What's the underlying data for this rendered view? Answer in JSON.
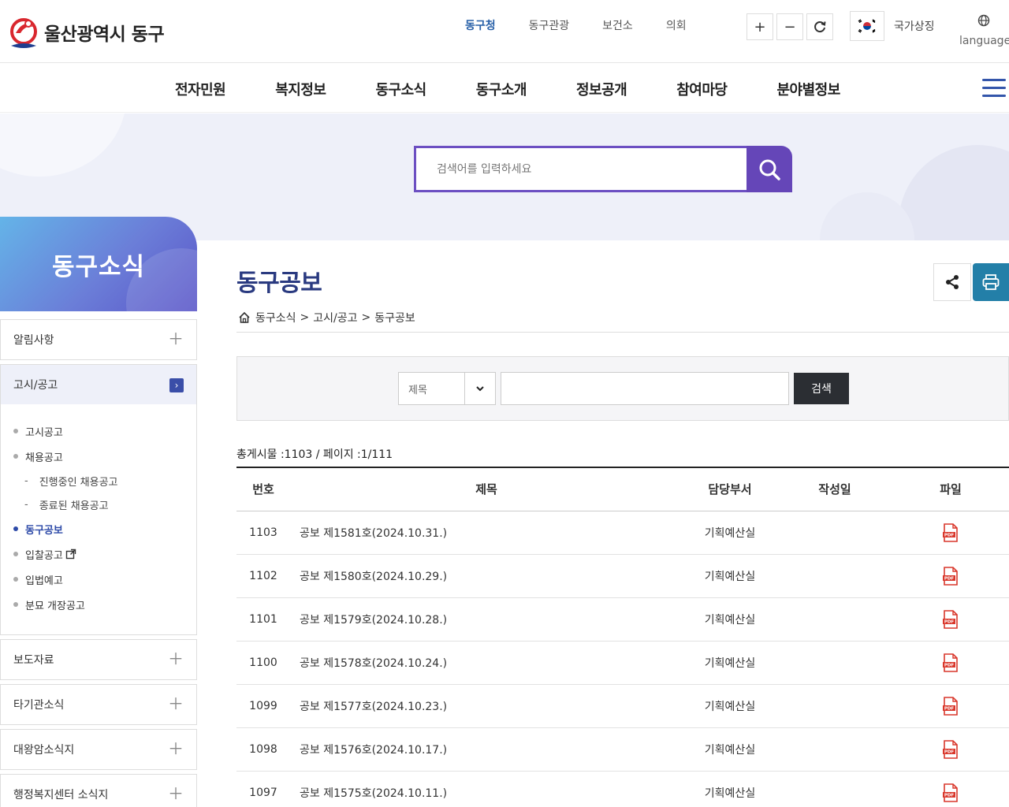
{
  "header": {
    "logo_text": "울산광역시 동구",
    "top_links": [
      "동구청",
      "동구관광",
      "보건소",
      "의회"
    ],
    "zoom_in": "+",
    "zoom_out": "−",
    "symbol_label": "국가상징",
    "language_label": "language"
  },
  "gnb": {
    "items": [
      "전자민원",
      "복지정보",
      "동구소식",
      "동구소개",
      "정보공개",
      "참여마당",
      "분야별정보"
    ]
  },
  "search": {
    "placeholder": "검색어를 입력하세요"
  },
  "sidebar": {
    "title": "동구소식",
    "menus": [
      {
        "label": "알림사항"
      },
      {
        "label": "고시/공고"
      },
      {
        "label": "보도자료"
      },
      {
        "label": "타기관소식"
      },
      {
        "label": "대왕암소식지"
      },
      {
        "label": "행정복지센터 소식지"
      }
    ],
    "sub_items": {
      "notice": "고시공고",
      "recruit": "채용공고",
      "recruit_ongoing": "진행중인 채용공고",
      "recruit_closed": "종료된 채용공고",
      "gazette": "동구공보",
      "bid": "입찰공고",
      "legislation": "입법예고",
      "grave": "분묘 개장공고"
    }
  },
  "content": {
    "title": "동구공보",
    "breadcrumb": [
      "동구소식",
      "고시/공고",
      "동구공보"
    ],
    "breadcrumb_sep": ">",
    "filter": {
      "select_value": "제목",
      "search_button": "검색"
    },
    "total": "총게시물 :1103 / 페이지 :1/111",
    "table": {
      "headers": [
        "번호",
        "제목",
        "담당부서",
        "작성일",
        "파일"
      ],
      "rows": [
        {
          "no": "1103",
          "title": "공보 제1581호(2024.10.31.)",
          "dept": "기획예산실",
          "date": ""
        },
        {
          "no": "1102",
          "title": "공보 제1580호(2024.10.29.)",
          "dept": "기획예산실",
          "date": ""
        },
        {
          "no": "1101",
          "title": "공보 제1579호(2024.10.28.)",
          "dept": "기획예산실",
          "date": ""
        },
        {
          "no": "1100",
          "title": "공보 제1578호(2024.10.24.)",
          "dept": "기획예산실",
          "date": ""
        },
        {
          "no": "1099",
          "title": "공보 제1577호(2024.10.23.)",
          "dept": "기획예산실",
          "date": ""
        },
        {
          "no": "1098",
          "title": "공보 제1576호(2024.10.17.)",
          "dept": "기획예산실",
          "date": ""
        },
        {
          "no": "1097",
          "title": "공보 제1575호(2024.10.11.)",
          "dept": "기획예산실",
          "date": ""
        }
      ]
    }
  },
  "colors": {
    "accent": "#6546b8",
    "navy": "#2a3a80",
    "print": "#237fa8",
    "pdf": "#d9372b"
  },
  "icons": [
    "logo-mark-icon",
    "refresh-icon",
    "flag-icon",
    "globe-icon",
    "hamburger-icon",
    "search-icon",
    "share-icon",
    "print-icon",
    "home-icon",
    "chevron-down-icon",
    "external-link-icon",
    "pdf-icon"
  ]
}
